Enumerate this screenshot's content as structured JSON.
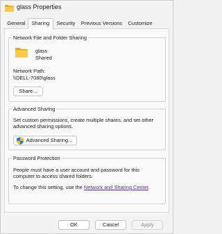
{
  "window": {
    "title": "glass Properties",
    "icon": "folder-icon"
  },
  "tabs": [
    {
      "label": "General",
      "active": false
    },
    {
      "label": "Sharing",
      "active": true
    },
    {
      "label": "Security",
      "active": false
    },
    {
      "label": "Previous Versions",
      "active": false
    },
    {
      "label": "Customize",
      "active": false
    }
  ],
  "network_sharing": {
    "group_title": "Network File and Folder Sharing",
    "folder_name": "glass",
    "folder_status": "Shared",
    "path_label": "Network Path:",
    "path_value": "\\\\DELL-7080\\glass",
    "share_button": "Share..."
  },
  "advanced_sharing": {
    "group_title": "Advanced Sharing",
    "desc_line1": "Set custom permissions, create multiple shares, and set other",
    "desc_line2": "advanced sharing options.",
    "button_label": "Advanced Sharing...",
    "button_icon": "shield-icon"
  },
  "password_protection": {
    "group_title": "Password Protection",
    "desc_line1": "People must have a user account and password for this",
    "desc_line2": "computer to access shared folders.",
    "change_text": "To change this setting, use the",
    "link_text": "Network and Sharing Center",
    "link_suffix": "."
  },
  "footer": {
    "ok": "OK",
    "cancel": "Cancel",
    "apply": "Apply"
  },
  "colors": {
    "link": "#5a2a86",
    "folder": "#f5c242"
  }
}
